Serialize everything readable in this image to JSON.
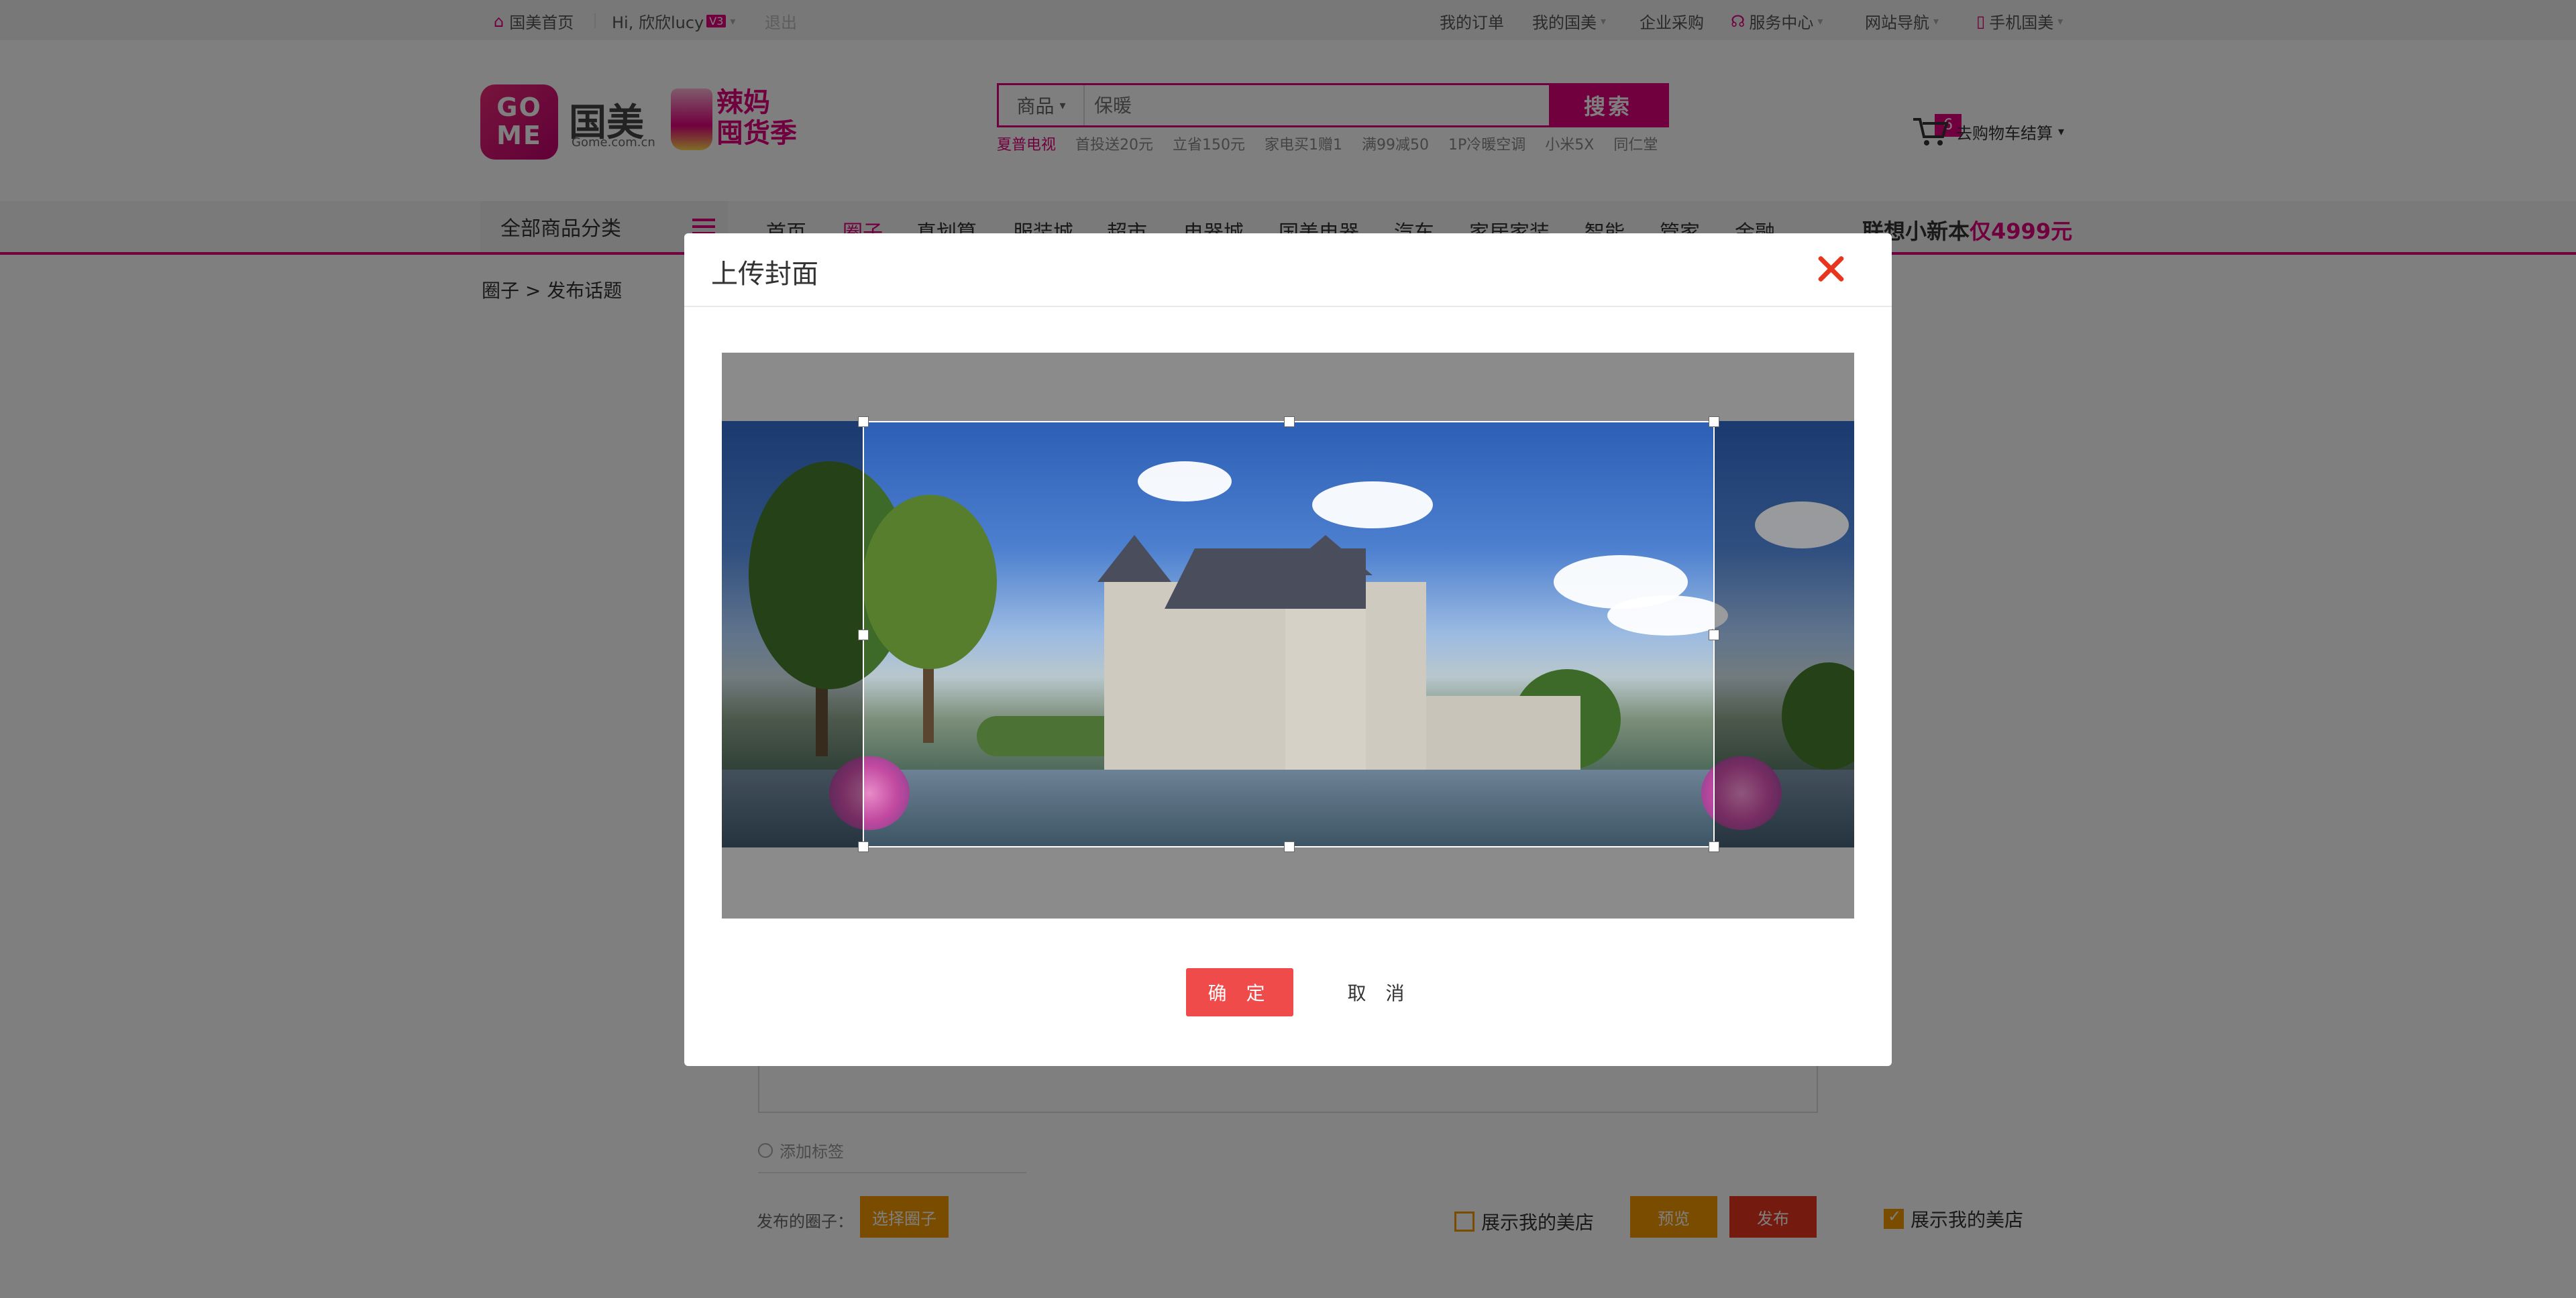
{
  "topbar": {
    "home": "国美首页",
    "greeting": "Hi, 欣欣lucy",
    "level": "V3",
    "logout": "退出",
    "my_orders": "我的订单",
    "my_gome": "我的国美",
    "enterprise": "企业采购",
    "service": "服务中心",
    "site_nav": "网站导航",
    "mobile": "手机国美"
  },
  "header": {
    "logo_mark": "GO ME",
    "logo_name": "国美",
    "logo_url": "Gome.com.cn",
    "promo_line1": "辣妈",
    "promo_line2": "囤货季",
    "search": {
      "category": "商品",
      "placeholder": "保暖",
      "button": "搜索",
      "hotwords": [
        "夏普电视",
        "首投送20元",
        "立省150元",
        "家电买1赠1",
        "满99减50",
        "1P冷暖空调",
        "小米5X",
        "同仁堂"
      ]
    },
    "cart": {
      "count": "6",
      "label": "去购物车结算"
    }
  },
  "nav": {
    "all_categories": "全部商品分类",
    "items": [
      "首页",
      "圈子",
      "真划算",
      "服装城",
      "超市",
      "电器城",
      "国美电器",
      "汽车",
      "家居家装",
      "智能",
      "管家",
      "金融"
    ],
    "promo_text": "联想小新本",
    "promo_price": "仅4999元"
  },
  "page": {
    "breadcrumb": "圈子 > 发布话题",
    "add_tag": "添加标签",
    "publish_circle_label": "发布的圈子：",
    "select_circle": "选择圈子",
    "show_store": "展示我的美店",
    "preview": "预览",
    "publish": "发布",
    "show_store_2": "展示我的美店"
  },
  "modal": {
    "title": "上传封面",
    "confirm": "确 定",
    "cancel": "取 消"
  },
  "colors": {
    "brand": "#e3007f",
    "confirm": "#ef4b4b",
    "orange": "#f39800"
  }
}
